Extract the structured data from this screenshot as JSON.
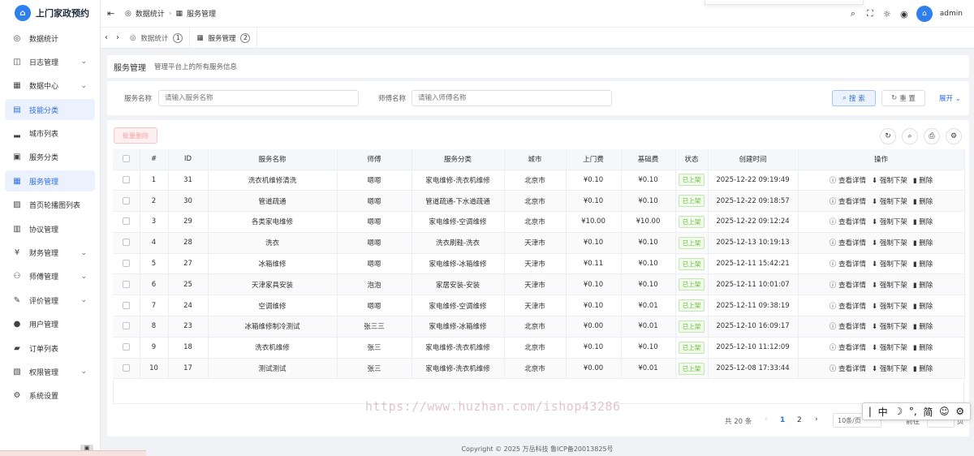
{
  "app": {
    "title": "上门家政预约",
    "logo_letter": "⌂"
  },
  "sidebar": {
    "items": [
      {
        "label": "数据统计",
        "icon": "◎",
        "arrow": ""
      },
      {
        "label": "日志管理",
        "icon": "◫",
        "arrow": "⌄"
      },
      {
        "label": "数据中心",
        "icon": "▦",
        "arrow": "⌄"
      },
      {
        "label": "技能分类",
        "icon": "▤",
        "arrow": ""
      },
      {
        "label": "城市列表",
        "icon": "▂",
        "arrow": ""
      },
      {
        "label": "服务分类",
        "icon": "▣",
        "arrow": ""
      },
      {
        "label": "服务管理",
        "icon": "▦",
        "arrow": ""
      },
      {
        "label": "首页轮播图列表",
        "icon": "▨",
        "arrow": ""
      },
      {
        "label": "协议管理",
        "icon": "▥",
        "arrow": ""
      },
      {
        "label": "财务管理",
        "icon": "¥",
        "arrow": "⌄"
      },
      {
        "label": "师傅管理",
        "icon": "⚇",
        "arrow": "⌄"
      },
      {
        "label": "评价管理",
        "icon": "✎",
        "arrow": "⌄"
      },
      {
        "label": "用户管理",
        "icon": "●",
        "arrow": ""
      },
      {
        "label": "订单列表",
        "icon": "▰",
        "arrow": ""
      },
      {
        "label": "权限管理",
        "icon": "▧",
        "arrow": "⌄"
      },
      {
        "label": "系统设置",
        "icon": "⚙",
        "arrow": ""
      }
    ]
  },
  "header": {
    "breadcrumb": [
      {
        "icon": "◎",
        "label": "数据统计"
      },
      {
        "icon": "▦",
        "label": "服务管理"
      }
    ],
    "username": "admin",
    "avatar_letter": "⌂"
  },
  "tabs": [
    {
      "icon": "◎",
      "label": "数据统计",
      "num": "1"
    },
    {
      "icon": "▦",
      "label": "服务管理",
      "num": "2"
    }
  ],
  "page": {
    "title": "服务管理",
    "description": "管理平台上的所有服务信息"
  },
  "search": {
    "name_label": "服务名称",
    "name_placeholder": "请输入服务名称",
    "master_label": "师傅名称",
    "master_placeholder": "请输入师傅名称",
    "search_button": "搜 索",
    "reset_button": "重 置",
    "expand_link": "展开"
  },
  "table": {
    "batch_delete": "批量删除",
    "columns": [
      "#",
      "ID",
      "服务名称",
      "师傅",
      "服务分类",
      "城市",
      "上门费",
      "基础费",
      "状态",
      "创建时间",
      "操作"
    ],
    "ops": {
      "view": "查看详情",
      "offline": "强制下架",
      "delete": "删除"
    },
    "rows": [
      {
        "idx": "1",
        "id": "31",
        "name": "洗衣机维修清洗",
        "master": "嗯嗯",
        "category": "家电维修-洗衣机维修",
        "city": "北京市",
        "visit_fee": "¥0.10",
        "base_fee": "¥0.10",
        "status": "已上架",
        "created": "2025-12-22 09:19:49"
      },
      {
        "idx": "2",
        "id": "30",
        "name": "管道疏通",
        "master": "嗯嗯",
        "category": "管道疏通-下水道疏通",
        "city": "北京市",
        "visit_fee": "¥0.10",
        "base_fee": "¥0.10",
        "status": "已上架",
        "created": "2025-12-22 09:18:57"
      },
      {
        "idx": "3",
        "id": "29",
        "name": "各类家电维修",
        "master": "嗯嗯",
        "category": "家电维修-空调维修",
        "city": "北京市",
        "visit_fee": "¥10.00",
        "base_fee": "¥10.00",
        "status": "已上架",
        "created": "2025-12-22 09:12:24"
      },
      {
        "idx": "4",
        "id": "28",
        "name": "洗衣",
        "master": "嗯嗯",
        "category": "洗衣刷鞋-洗衣",
        "city": "天津市",
        "visit_fee": "¥0.10",
        "base_fee": "¥0.10",
        "status": "已上架",
        "created": "2025-12-13 10:19:13"
      },
      {
        "idx": "5",
        "id": "27",
        "name": "冰箱维修",
        "master": "嗯嗯",
        "category": "家电维修-冰箱维修",
        "city": "天津市",
        "visit_fee": "¥0.11",
        "base_fee": "¥0.10",
        "status": "已上架",
        "created": "2025-12-11 15:42:21"
      },
      {
        "idx": "6",
        "id": "25",
        "name": "天津家具安装",
        "master": "泡泡",
        "category": "家居安装-安装",
        "city": "天津市",
        "visit_fee": "¥0.10",
        "base_fee": "¥0.10",
        "status": "已上架",
        "created": "2025-12-11 10:01:07"
      },
      {
        "idx": "7",
        "id": "24",
        "name": "空调维修",
        "master": "嗯嗯",
        "category": "家电维修-空调维修",
        "city": "天津市",
        "visit_fee": "¥0.10",
        "base_fee": "¥0.01",
        "status": "已上架",
        "created": "2025-12-11 09:38:19"
      },
      {
        "idx": "8",
        "id": "23",
        "name": "冰箱维修制冷测试",
        "master": "张三三",
        "category": "家电维修-冰箱维修",
        "city": "北京市",
        "visit_fee": "¥0.00",
        "base_fee": "¥0.01",
        "status": "已上架",
        "created": "2025-12-10 16:09:17"
      },
      {
        "idx": "9",
        "id": "18",
        "name": "洗衣机维修",
        "master": "张三",
        "category": "家电维修-洗衣机维修",
        "city": "北京市",
        "visit_fee": "¥0.10",
        "base_fee": "¥0.10",
        "status": "已上架",
        "created": "2025-12-10 11:12:09"
      },
      {
        "idx": "10",
        "id": "17",
        "name": "测试测试",
        "master": "张三",
        "category": "家电维修-洗衣机维修",
        "city": "北京市",
        "visit_fee": "¥0.00",
        "base_fee": "¥0.01",
        "status": "已上架",
        "created": "2025-12-08 17:33:44"
      }
    ]
  },
  "pagination": {
    "total": "共 20 条",
    "pages": [
      "1",
      "2"
    ],
    "current": "1",
    "page_size": "10条/页",
    "goto": "前往",
    "page_unit": "页"
  },
  "footer": {
    "copyright": "Copyright © 2025 万岳科技 鲁ICP备20013825号"
  },
  "watermark": "https://www.huzhan.com/ishop43286",
  "ime": [
    "|",
    "中",
    "☽",
    "°,",
    "简",
    "☺",
    "⚙"
  ],
  "colors": {
    "primary": "#2f6fe0",
    "success": "#67c23a",
    "danger": "#f56c6c"
  }
}
